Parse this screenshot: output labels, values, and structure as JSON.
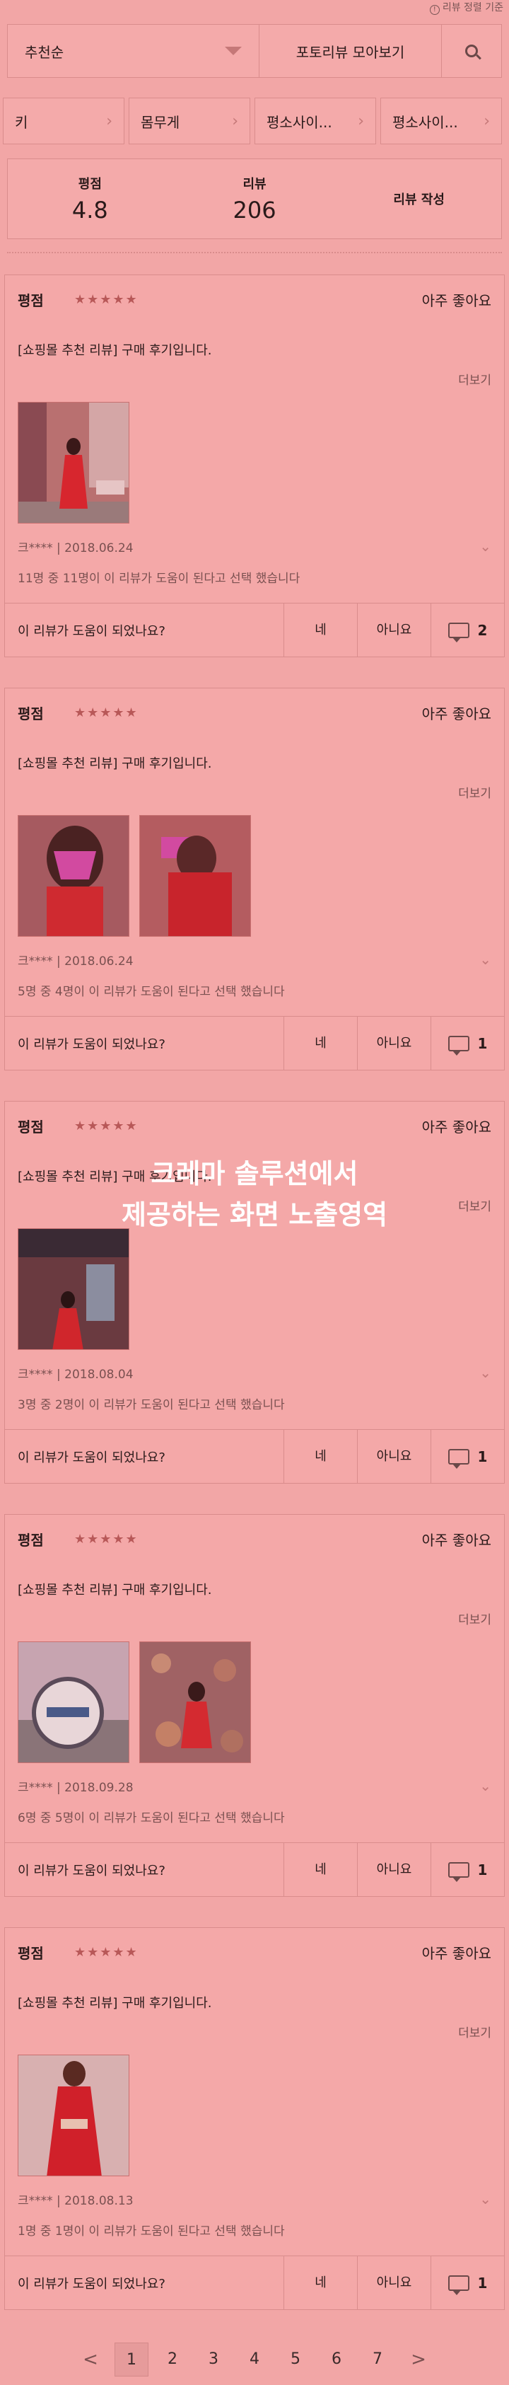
{
  "top_note": "리뷰 정렬 기준",
  "sort": {
    "selected": "추천순"
  },
  "photo_reviews_label": "포토리뷰 모아보기",
  "filters": [
    {
      "label": "키"
    },
    {
      "label": "몸무게"
    },
    {
      "label": "평소사이..."
    },
    {
      "label": "평소사이..."
    }
  ],
  "summary": {
    "rating_label": "평점",
    "rating_value": "4.8",
    "review_label": "리뷰",
    "review_value": "206",
    "write_label": "리뷰 작성"
  },
  "reviews": [
    {
      "rating_label": "평점",
      "stars": "★★★★★",
      "verdict": "아주 좋아요",
      "title": "[쇼핑몰 추천 리뷰] 구매 후기입니다.",
      "more": "더보기",
      "author_date": "크**** | 2018.06.24",
      "helpful": "11명 중 11명이 이 리뷰가 도움이 된다고 선택 했습니다",
      "question": "이 리뷰가 도움이 되었나요?",
      "yes": "네",
      "no": "아니요",
      "comments": "2",
      "photo_count": 1
    },
    {
      "rating_label": "평점",
      "stars": "★★★★★",
      "verdict": "아주 좋아요",
      "title": "[쇼핑몰 추천 리뷰] 구매 후기입니다.",
      "more": "더보기",
      "author_date": "크**** | 2018.06.24",
      "helpful": "5명 중 4명이 이 리뷰가 도움이 된다고 선택 했습니다",
      "question": "이 리뷰가 도움이 되었나요?",
      "yes": "네",
      "no": "아니요",
      "comments": "1",
      "photo_count": 2
    },
    {
      "rating_label": "평점",
      "stars": "★★★★★",
      "verdict": "아주 좋아요",
      "title": "[쇼핑몰 추천 리뷰] 구매 후기입니다.",
      "more": "더보기",
      "author_date": "크**** | 2018.08.04",
      "helpful": "3명 중 2명이 이 리뷰가 도움이 된다고 선택 했습니다",
      "question": "이 리뷰가 도움이 되었나요?",
      "yes": "네",
      "no": "아니요",
      "comments": "1",
      "photo_count": 1
    },
    {
      "rating_label": "평점",
      "stars": "★★★★★",
      "verdict": "아주 좋아요",
      "title": "[쇼핑몰 추천 리뷰] 구매 후기입니다.",
      "more": "더보기",
      "author_date": "크**** | 2018.09.28",
      "helpful": "6명 중 5명이 이 리뷰가 도움이 된다고 선택 했습니다",
      "question": "이 리뷰가 도움이 되었나요?",
      "yes": "네",
      "no": "아니요",
      "comments": "1",
      "photo_count": 2
    },
    {
      "rating_label": "평점",
      "stars": "★★★★★",
      "verdict": "아주 좋아요",
      "title": "[쇼핑몰 추천 리뷰] 구매 후기입니다.",
      "more": "더보기",
      "author_date": "크**** | 2018.08.13",
      "helpful": "1명 중 1명이 이 리뷰가 도움이 된다고 선택 했습니다",
      "question": "이 리뷰가 도움이 되었나요?",
      "yes": "네",
      "no": "아니요",
      "comments": "1",
      "photo_count": 1
    }
  ],
  "overlay_note": [
    "크레마 솔루션에서",
    "제공하는 화면 노출영역"
  ],
  "pagination": {
    "prev": "<",
    "next": ">",
    "pages": [
      "1",
      "2",
      "3",
      "4",
      "5",
      "6",
      "7"
    ],
    "current": "1"
  }
}
